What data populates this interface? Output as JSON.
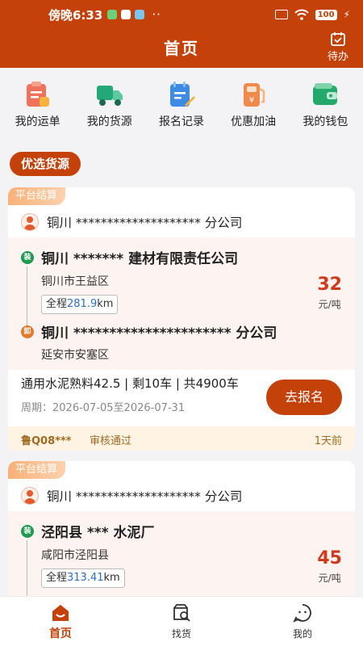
{
  "status_bar": {
    "time": "傍晚6:33",
    "battery": "100"
  },
  "header": {
    "title": "首页",
    "todo_label": "待办"
  },
  "quick_actions": [
    {
      "label": "我的运单",
      "icon": "waybill-icon"
    },
    {
      "label": "我的货源",
      "icon": "truck-icon"
    },
    {
      "label": "报名记录",
      "icon": "signup-record-icon"
    },
    {
      "label": "优惠加油",
      "icon": "fuel-pump-icon"
    },
    {
      "label": "我的钱包",
      "icon": "wallet-icon"
    }
  ],
  "section_title": "优选货源",
  "cards": [
    {
      "tag": "平台结算",
      "shipper": "铜川 ******************** 分公司",
      "load_badge": "装",
      "load_name": "铜川 ******* 建材有限责任公司",
      "load_area": "铜川市王益区",
      "distance_prefix": "全程",
      "distance_value": "281.9",
      "distance_unit": "km",
      "unload_badge": "卸",
      "unload_name": "铜川 ********************** 分公司",
      "unload_area": "延安市安塞区",
      "price": "32",
      "price_unit": "元/吨",
      "goods": "通用水泥熟料42.5 | 剩10车 | 共4900车",
      "period": "周期：2026-07-05至2026-07-31",
      "button": "去报名",
      "plate": "鲁Q08***",
      "audit": "审核通过",
      "ago": "1天前"
    },
    {
      "tag": "平台结算",
      "shipper": "铜川 ******************** 分公司",
      "load_badge": "装",
      "load_name": "泾阳县 *** 水泥厂",
      "load_area": "咸阳市泾阳县",
      "distance_prefix": "全程",
      "distance_value": "313.41",
      "distance_unit": "km",
      "price": "45",
      "price_unit": "元/吨"
    }
  ],
  "tabbar": [
    {
      "label": "首页",
      "icon": "home-icon",
      "active": true
    },
    {
      "label": "找货",
      "icon": "find-cargo-icon"
    },
    {
      "label": "我的",
      "icon": "profile-icon"
    }
  ],
  "colors": {
    "brand": "#c5410a",
    "price": "#d0391b",
    "distance": "#2d6fc4",
    "load": "#1f9a4e",
    "unload": "#e37a2e"
  }
}
